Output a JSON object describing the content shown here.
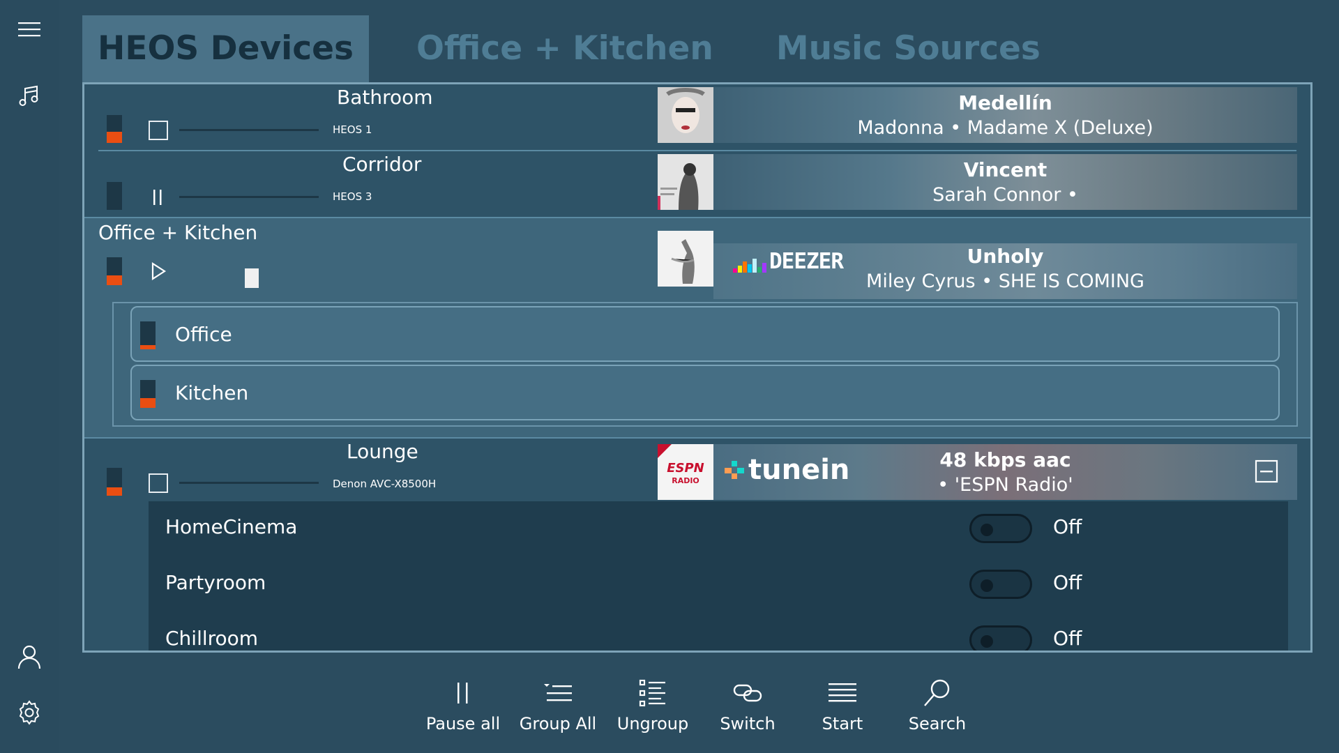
{
  "tabs": [
    {
      "label": "HEOS Devices"
    },
    {
      "label": "Office + Kitchen"
    },
    {
      "label": "Music Sources"
    }
  ],
  "zones": [
    {
      "name": "Bathroom",
      "model": "HEOS 1",
      "volume": 0.4,
      "state": "stopped",
      "now_playing": {
        "title": "Medellín",
        "subtitle": "Madonna • Madame X (Deluxe)"
      }
    },
    {
      "name": "Corridor",
      "model": "HEOS 3",
      "volume": 0.0,
      "state": "playing",
      "now_playing": {
        "title": "Vincent",
        "subtitle": "Sarah Connor •"
      }
    },
    {
      "name": "Lounge",
      "model": "Denon AVC-X8500H",
      "volume": 0.3,
      "state": "stopped",
      "now_playing": {
        "source": "tunein",
        "title": "48 kbps aac",
        "subtitle": "• 'ESPN Radio'"
      }
    }
  ],
  "group": {
    "name": "Office + Kitchen",
    "volume": 0.35,
    "state": "paused",
    "source": "DEEZER",
    "now_playing": {
      "title": "Unholy",
      "subtitle": "Miley Cyrus • SHE IS COMING"
    },
    "members": [
      {
        "name": "Office",
        "volume": 0.15
      },
      {
        "name": "Kitchen",
        "volume": 0.35
      }
    ]
  },
  "lounge_zones": [
    {
      "name": "HomeCinema",
      "state": "Off"
    },
    {
      "name": "Partyroom",
      "state": "Off"
    },
    {
      "name": "Chillroom",
      "state": "Off"
    }
  ],
  "toolbar": [
    {
      "label": "Pause all",
      "icon": "pause-icon"
    },
    {
      "label": "Group All",
      "icon": "group-icon"
    },
    {
      "label": "Ungroup",
      "icon": "ungroup-icon"
    },
    {
      "label": "Switch",
      "icon": "link-icon"
    },
    {
      "label": "Start",
      "icon": "list-icon"
    },
    {
      "label": "Search",
      "icon": "search-icon"
    }
  ],
  "colors": {
    "accent": "#ea4e12",
    "background": "#2b4c5f",
    "panel": "#2e5367"
  },
  "rail_icons": [
    "hamburger-icon",
    "music-note-icon",
    "user-icon",
    "gear-icon"
  ]
}
